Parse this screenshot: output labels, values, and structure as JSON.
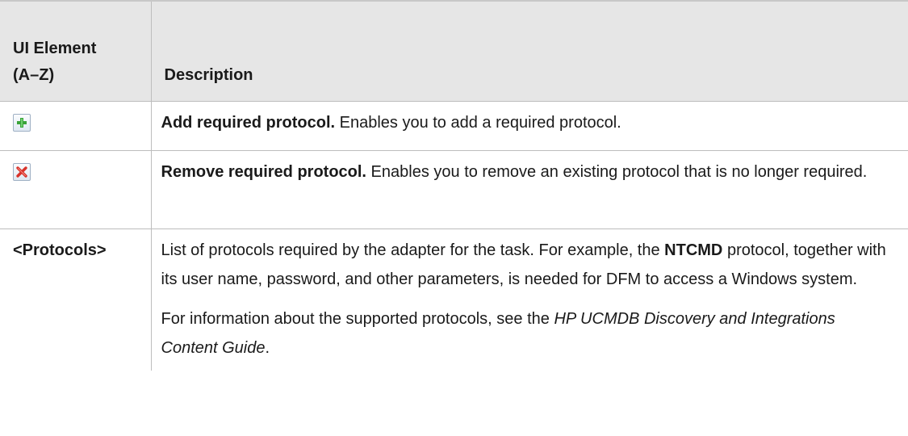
{
  "header": {
    "col_element_line1": "UI Element",
    "col_element_line2": "(A–Z)",
    "col_description": "Description"
  },
  "rows": [
    {
      "icon": "add-plus-icon",
      "title": "Add required protocol.",
      "text": " Enables you to add a required protocol."
    },
    {
      "icon": "remove-x-icon",
      "title": "Remove required protocol.",
      "text": " Enables you to remove an existing protocol that is no longer required."
    },
    {
      "element": "<Protocols>",
      "p1_before": "List of protocols required by the adapter for the task. For example, the ",
      "p1_bold": "NTCMD",
      "p1_after": " protocol, together with its user name, password, and other parameters, is needed for DFM to access a Windows system.",
      "p2_before": "For information about the supported protocols, see the ",
      "p2_italic": "HP UCMDB Discovery and Integrations Content Guide",
      "p2_after": "."
    }
  ],
  "colors": {
    "header_bg": "#e6e6e6",
    "border": "#bdbdbd",
    "add_icon": "#3aa33a",
    "remove_icon": "#d8322a"
  }
}
